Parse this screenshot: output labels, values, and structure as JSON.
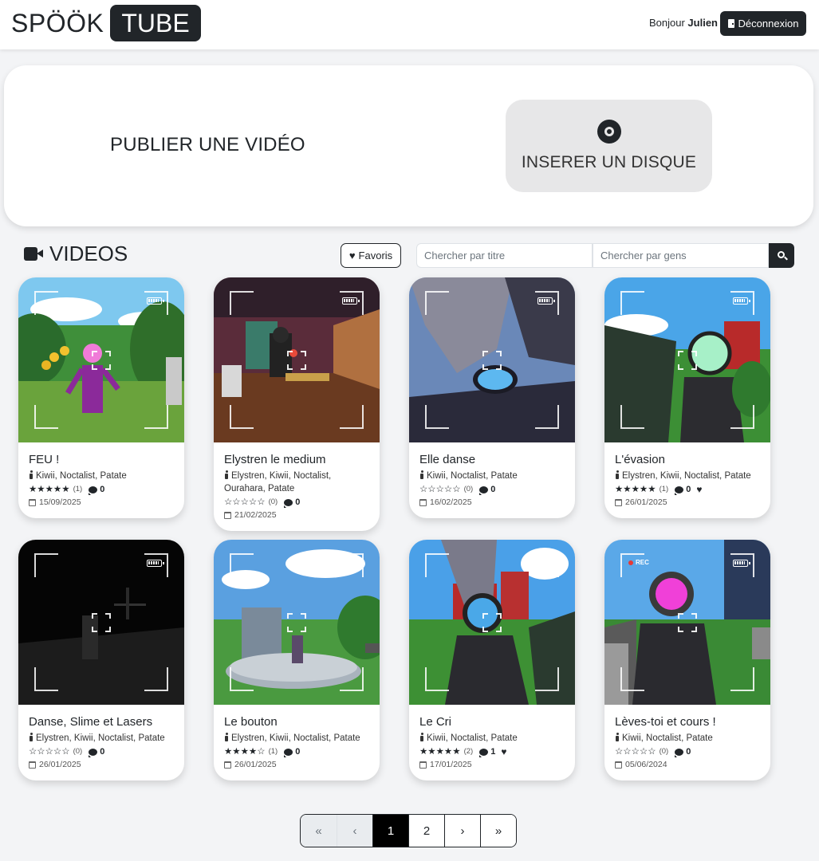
{
  "header": {
    "logo_part1": "SPÖÖK",
    "logo_part2": "TUBE",
    "greeting": "Bonjour",
    "username": "Julien",
    "logout_label": "Déconnexion"
  },
  "publish": {
    "title": "PUBLIER UNE VIDÉO",
    "insert_disc_label": "INSERER UN DISQUE"
  },
  "videos_section": {
    "title": "VIDEOS",
    "favorites_label": "Favoris",
    "search_title_placeholder": "Chercher par titre",
    "search_people_placeholder": "Chercher par gens"
  },
  "videos": [
    {
      "title": "FEU !",
      "people": "Kiwii, Noctalist, Patate",
      "rating": 5,
      "ratings_count": "(1)",
      "comments": "0",
      "favorite": false,
      "date": "15/09/2025",
      "scene": "field"
    },
    {
      "title": "Elystren le medium",
      "people": "Elystren, Kiwii, Noctalist, Ourahara, Patate",
      "rating": 0,
      "ratings_count": "(0)",
      "comments": "0",
      "favorite": false,
      "date": "21/02/2025",
      "scene": "room"
    },
    {
      "title": "Elle danse",
      "people": "Kiwii, Noctalist, Patate",
      "rating": 0,
      "ratings_count": "(0)",
      "comments": "0",
      "favorite": false,
      "date": "16/02/2025",
      "scene": "closeup"
    },
    {
      "title": "L'évasion",
      "people": "Elystren, Kiwii, Noctalist, Patate",
      "rating": 5,
      "ratings_count": "(1)",
      "comments": "0",
      "favorite": true,
      "date": "26/01/2025",
      "scene": "forest"
    },
    {
      "title": "Danse, Slime et Lasers",
      "people": "Elystren, Kiwii, Noctalist, Patate",
      "rating": 0,
      "ratings_count": "(0)",
      "comments": "0",
      "favorite": false,
      "date": "26/01/2025",
      "scene": "dark"
    },
    {
      "title": "Le bouton",
      "people": "Elystren, Kiwii, Noctalist, Patate",
      "rating": 4,
      "ratings_count": "(1)",
      "comments": "0",
      "favorite": false,
      "date": "26/01/2025",
      "scene": "platform"
    },
    {
      "title": "Le Cri",
      "people": "Kiwii, Noctalist, Patate",
      "rating": 5,
      "ratings_count": "(2)",
      "comments": "1",
      "favorite": true,
      "date": "17/01/2025",
      "scene": "barn"
    },
    {
      "title": "Lèves-toi et cours !",
      "people": "Kiwii, Noctalist, Patate",
      "rating": 0,
      "ratings_count": "(0)",
      "comments": "0",
      "favorite": false,
      "date": "05/06/2024",
      "scene": "rec",
      "overlay_label": "REC"
    }
  ],
  "pagination": {
    "first": "«",
    "prev": "‹",
    "pages": [
      "1",
      "2"
    ],
    "current": "1",
    "next": "›",
    "last": "»"
  },
  "colors": {
    "dark": "#212529",
    "background": "#f3f4f6",
    "panel": "#ffffff",
    "disc_button": "#e7e7e8"
  },
  "icons": {
    "logout": "door-icon",
    "disc": "disc-icon",
    "section": "video-camera-icon",
    "favorites": "heart-icon",
    "search": "search-icon",
    "person": "person-icon",
    "comments": "comment-icon",
    "date": "calendar-icon"
  }
}
